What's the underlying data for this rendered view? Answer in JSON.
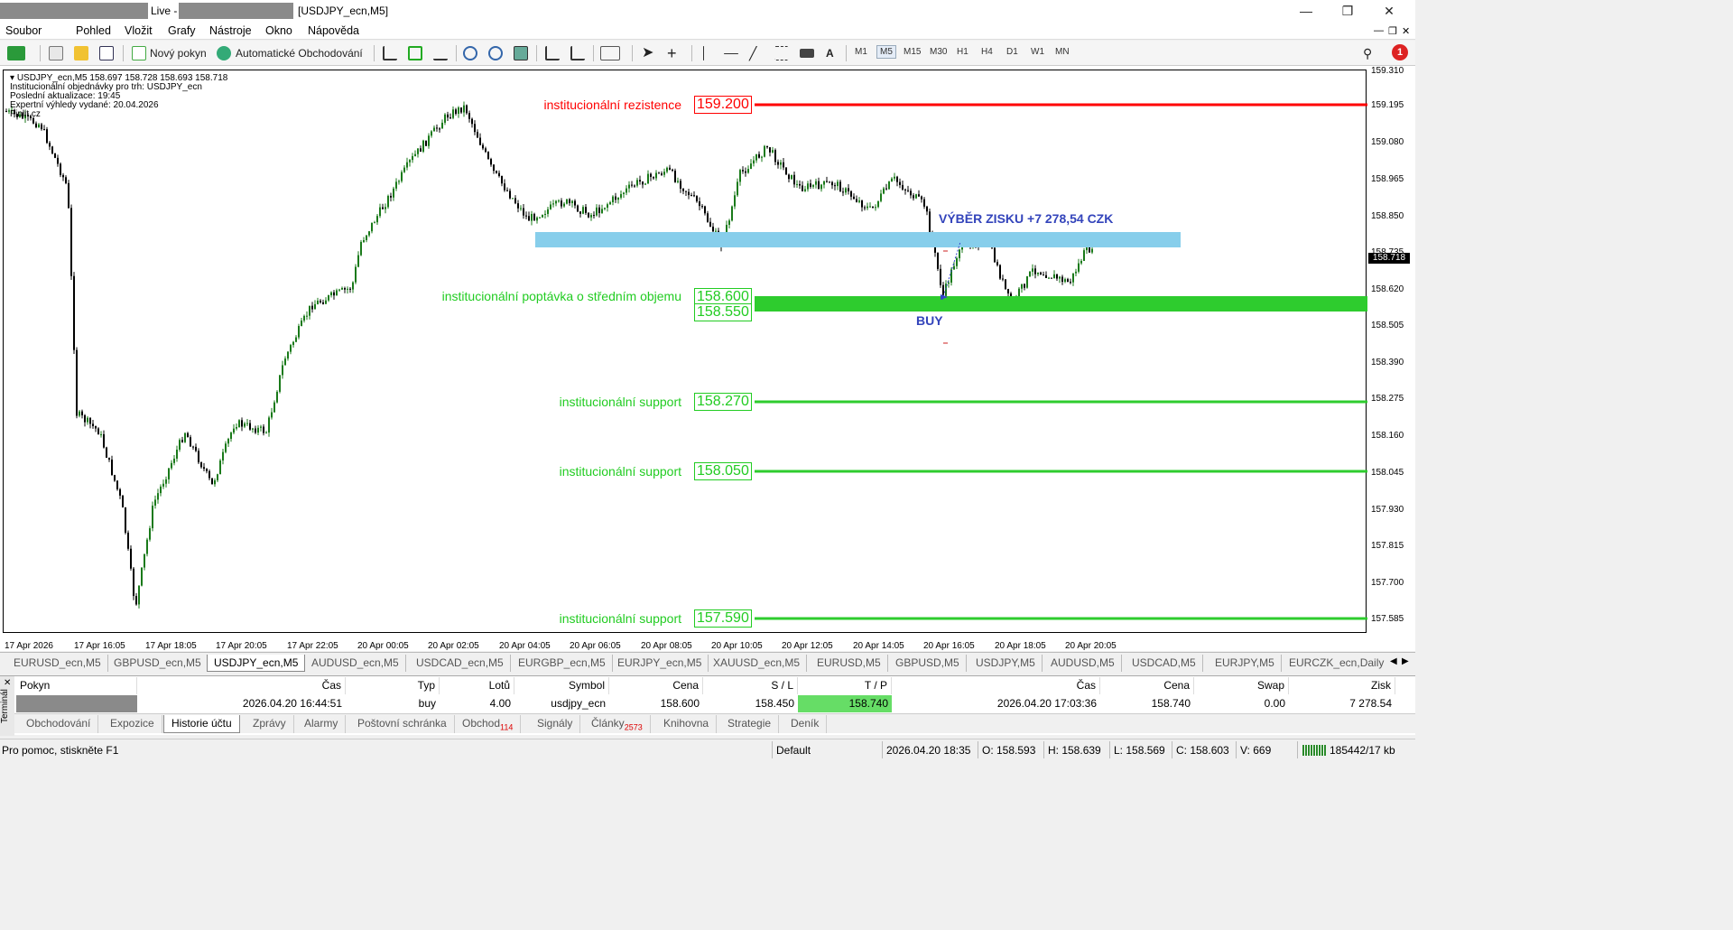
{
  "titlebar": {
    "live": "Live -",
    "window": "[USDJPY_ecn,M5]",
    "minimize": "—",
    "restore": "❐",
    "close": "✕"
  },
  "menu": [
    "Soubor",
    "Pohled",
    "Vložit",
    "Grafy",
    "Nástroje",
    "Okno",
    "Nápověda"
  ],
  "toolbar": {
    "new_order": "Nový pokyn",
    "auto_trading": "Automatické Obchodování",
    "timeframes": [
      "M1",
      "M5",
      "M15",
      "M30",
      "H1",
      "H4",
      "D1",
      "W1",
      "MN"
    ],
    "selected_tf": "M5",
    "text_tool": "A",
    "notif_count": "1"
  },
  "chart": {
    "symbol_line": "USDJPY_ecn,M5  158.697 158.728 158.693 158.718",
    "info_lines": [
      "Institucionální objednávky pro trh: USDJPY_ecn",
      "Poslední aktualizace: 19:45",
      "Expertní výhledy vydané: 20.04.2026",
      "Finlit.cz"
    ],
    "levels": [
      {
        "label": "institucionální rezistence",
        "price": "159.200",
        "color": "#ff0000"
      },
      {
        "label": "institucionální poptávka o středním objemu",
        "price": "158.600",
        "price2": "158.550",
        "color": "#22cc22"
      },
      {
        "label": "institucionální support",
        "price": "158.270",
        "color": "#22cc22"
      },
      {
        "label": "institucionální support",
        "price": "158.050",
        "color": "#22cc22"
      },
      {
        "label": "institucionální support",
        "price": "157.590",
        "color": "#22cc22"
      }
    ],
    "profit_text": "VÝBĚR ZISKU +7 278,54 CZK",
    "buy_text": "BUY",
    "price_scale": [
      "159.310",
      "159.195",
      "159.080",
      "158.965",
      "158.850",
      "158.735",
      "158.620",
      "158.505",
      "158.390",
      "158.275",
      "158.160",
      "158.045",
      "157.930",
      "157.815",
      "157.700",
      "157.585"
    ],
    "current_price": "158.718",
    "time_labels": [
      "17 Apr 2026",
      "17 Apr 16:05",
      "17 Apr 18:05",
      "17 Apr 20:05",
      "17 Apr 22:05",
      "20 Apr 00:05",
      "20 Apr 02:05",
      "20 Apr 04:05",
      "20 Apr 06:05",
      "20 Apr 08:05",
      "20 Apr 10:05",
      "20 Apr 12:05",
      "20 Apr 14:05",
      "20 Apr 16:05",
      "20 Apr 18:05",
      "20 Apr 20:05"
    ]
  },
  "chart_tabs": [
    "EURUSD_ecn,M5",
    "GBPUSD_ecn,M5",
    "USDJPY_ecn,M5",
    "AUDUSD_ecn,M5",
    "USDCAD_ecn,M5",
    "EURGBP_ecn,M5",
    "EURJPY_ecn,M5",
    "XAUUSD_ecn,M5",
    "EURUSD,M5",
    "GBPUSD,M5",
    "USDJPY,M5",
    "AUDUSD,M5",
    "USDCAD,M5",
    "EURJPY,M5",
    "EURCZK_ecn,Daily"
  ],
  "active_chart_tab": 2,
  "terminal": {
    "side_label": "Terminál",
    "headers": [
      "Pokyn",
      "Čas",
      "Typ",
      "Lotů",
      "Symbol",
      "Cena",
      "S / L",
      "T / P",
      "Čas",
      "Cena",
      "Swap",
      "Zisk"
    ],
    "row": [
      "",
      "2026.04.20 16:44:51",
      "buy",
      "4.00",
      "usdjpy_ecn",
      "158.600",
      "158.450",
      "158.740",
      "2026.04.20 17:03:36",
      "158.740",
      "0.00",
      "7 278.54"
    ],
    "tabs": [
      {
        "l": "Obchodování"
      },
      {
        "l": "Expozice"
      },
      {
        "l": "Historie účtu"
      },
      {
        "l": "Zprávy"
      },
      {
        "l": "Alarmy"
      },
      {
        "l": "Poštovní schránka"
      },
      {
        "l": "Obchod",
        "b": "114"
      },
      {
        "l": "Signály"
      },
      {
        "l": "Články",
        "b": "2573"
      },
      {
        "l": "Knihovna"
      },
      {
        "l": "Strategie"
      },
      {
        "l": "Deník"
      }
    ],
    "active_tab": 2
  },
  "status": {
    "help": "Pro pomoc, stiskněte F1",
    "profile": "Default",
    "datetime": "2026.04.20 18:35",
    "open": "O: 158.593",
    "high": "H: 158.639",
    "low": "L: 158.569",
    "close": "C: 158.603",
    "volume": "V: 669",
    "traffic": "185442/17 kb"
  }
}
